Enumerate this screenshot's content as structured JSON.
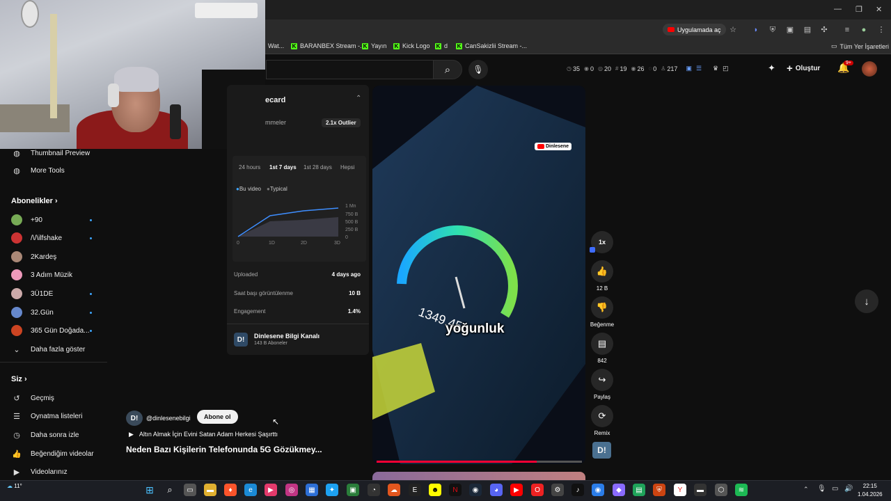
{
  "browser": {
    "open_app_label": "Uygulamada aç",
    "bookmarks": [
      "Wat...",
      "BARANBEX Stream -...",
      "Yayın",
      "Kick Logo",
      "d",
      "CanSakizlii Stream -..."
    ],
    "all_bookmarks_label": "Tüm Yer İşaretleri"
  },
  "header": {
    "stats": [
      "35",
      "0",
      "20",
      "19",
      "26",
      "0",
      "217"
    ],
    "create_label": "Oluştur",
    "notif_badge": "9+"
  },
  "sidebar": {
    "tools": [
      "Thumbnail Preview",
      "More Tools"
    ],
    "subscriptions_title": "Abonelikler",
    "subscriptions": [
      {
        "name": "+90",
        "color": "#7a5"
      },
      {
        "name": "/\\/\\ilfshake",
        "color": "#c33"
      },
      {
        "name": "2Kardeş",
        "color": "#a87"
      },
      {
        "name": "3 Adım Müzik",
        "color": "#e9b"
      },
      {
        "name": "3Ü1DE",
        "color": "#caa"
      },
      {
        "name": "32.Gün",
        "color": "#68c"
      },
      {
        "name": "365 Gün Doğada...",
        "color": "#c42"
      }
    ],
    "show_more": "Daha fazla göster",
    "you_title": "Siz",
    "you_items": [
      "Geçmiş",
      "Oynatma listeleri",
      "Daha sonra izle",
      "Beğendiğim videolar",
      "Videolarınız"
    ]
  },
  "panel": {
    "title": "ecard",
    "subtitle": "mmeler",
    "outlier": "2.1x Outlier",
    "ranges": [
      "24 hours",
      "1st 7 days",
      "1st 28 days",
      "Hepsi"
    ],
    "legend_this": "Bu video",
    "legend_typical": "Typical",
    "y_ticks": [
      "1 Mn",
      "750 B",
      "500 B",
      "250 B",
      "0"
    ],
    "x_ticks": [
      "0",
      "1D",
      "2D",
      "3D"
    ],
    "uploaded_label": "Uploaded",
    "uploaded_value": "4 days ago",
    "hourly_label": "Saat başı görüntülenme",
    "hourly_value": "10 B",
    "engagement_label": "Engagement",
    "engagement_value": "1.4%",
    "channel_name": "Dinlesene Bilgi Kanalı",
    "channel_subs": "143 B Aboneler"
  },
  "video": {
    "badge": "Dinlesene",
    "caption": "yoğunluk",
    "speed_reading": "1349.45",
    "progress": 0.78
  },
  "actions": {
    "speed": "1x",
    "likes": "12 B",
    "dislike_label": "Beğenme",
    "comments": "842",
    "share_label": "Paylaş",
    "remix_label": "Remix"
  },
  "info": {
    "channel_handle": "@dinlesenebilgi",
    "subscribe_label": "Abone ol",
    "playlist_line": "Altın Almak İçin Evini Satan Adam Herkesi Şaşırttı",
    "title": "Neden Bazı Kişilerin Telefonunda 5G Gözükmey..."
  },
  "taskbar": {
    "time": "22:15",
    "date": "1.04.2026",
    "weather": "11°"
  }
}
